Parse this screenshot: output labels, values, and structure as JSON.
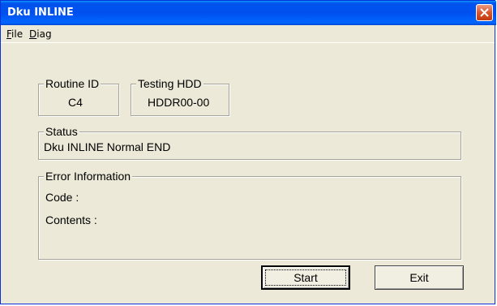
{
  "window": {
    "title": "Dku INLINE"
  },
  "menu": [
    {
      "mnemonic": "F",
      "rest": "ile"
    },
    {
      "mnemonic": "D",
      "rest": "iag"
    }
  ],
  "routine": {
    "label": "Routine ID",
    "value": "C4"
  },
  "testing": {
    "label": "Testing HDD",
    "value": "HDDR00-00"
  },
  "status": {
    "label": "Status",
    "value": "Dku INLINE Normal END"
  },
  "error": {
    "label": "Error Information",
    "code_label": "Code :",
    "contents_label": "Contents :"
  },
  "buttons": {
    "start": "Start",
    "exit": "Exit"
  },
  "icons": {
    "close": "close-icon"
  },
  "colors": {
    "titlebar": "#0053ee",
    "close": "#d9572f",
    "face": "#ece9d8"
  }
}
